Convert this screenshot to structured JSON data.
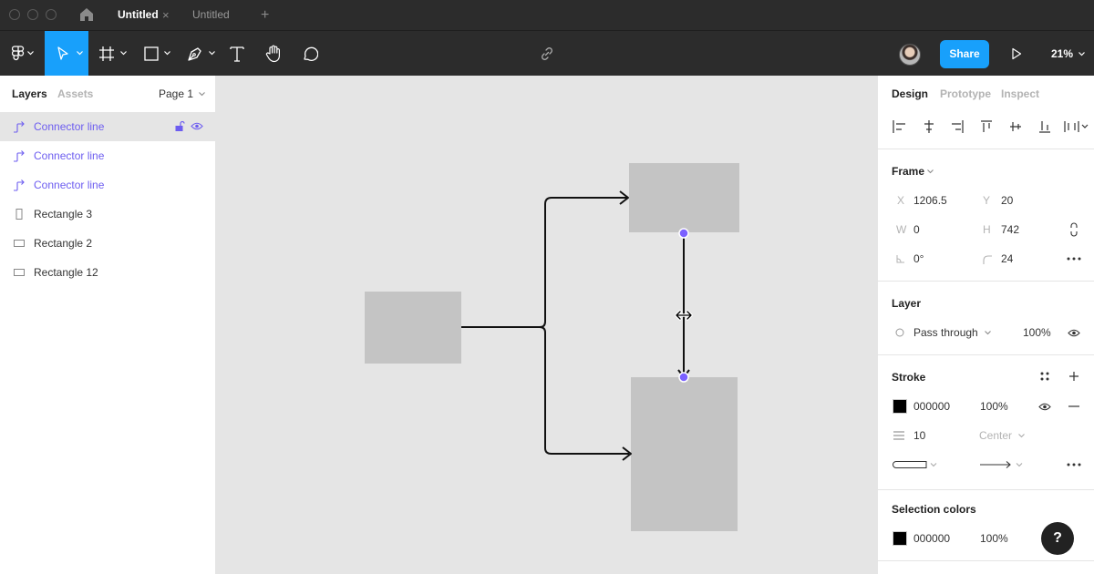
{
  "tabs": [
    {
      "label": "Untitled",
      "active": true
    },
    {
      "label": "Untitled",
      "active": false
    }
  ],
  "tab_close": "×",
  "tab_add": "+",
  "toolbar": {
    "share_label": "Share",
    "zoom_label": "21%",
    "accent_color": "#18a0fb"
  },
  "left_panel": {
    "tab_layers": "Layers",
    "tab_assets": "Assets",
    "page_select": "Page 1",
    "layers": [
      {
        "label": "Connector line",
        "kind": "connector",
        "selected": true
      },
      {
        "label": "Connector line",
        "kind": "connector",
        "selected": false
      },
      {
        "label": "Connector line",
        "kind": "connector",
        "selected": false
      },
      {
        "label": "Rectangle 3",
        "kind": "rect-tall",
        "selected": false
      },
      {
        "label": "Rectangle 2",
        "kind": "rect",
        "selected": false
      },
      {
        "label": "Rectangle 12",
        "kind": "rect",
        "selected": false
      }
    ]
  },
  "right_panel": {
    "tab_design": "Design",
    "tab_prototype": "Prototype",
    "tab_inspect": "Inspect",
    "frame": {
      "title": "Frame",
      "x_label": "X",
      "x_value": "1206.5",
      "y_label": "Y",
      "y_value": "20",
      "w_label": "W",
      "w_value": "0",
      "h_label": "H",
      "h_value": "742",
      "rotation_value": "0°",
      "radius_value": "24"
    },
    "layer": {
      "title": "Layer",
      "blend_mode": "Pass through",
      "opacity": "100%"
    },
    "stroke": {
      "title": "Stroke",
      "color_hex": "000000",
      "color": "#000000",
      "opacity": "100%",
      "weight": "10",
      "align": "Center"
    },
    "selection_colors": {
      "title": "Selection colors",
      "color_hex": "000000",
      "color": "#000000",
      "opacity": "100%"
    }
  },
  "help_label": "?"
}
